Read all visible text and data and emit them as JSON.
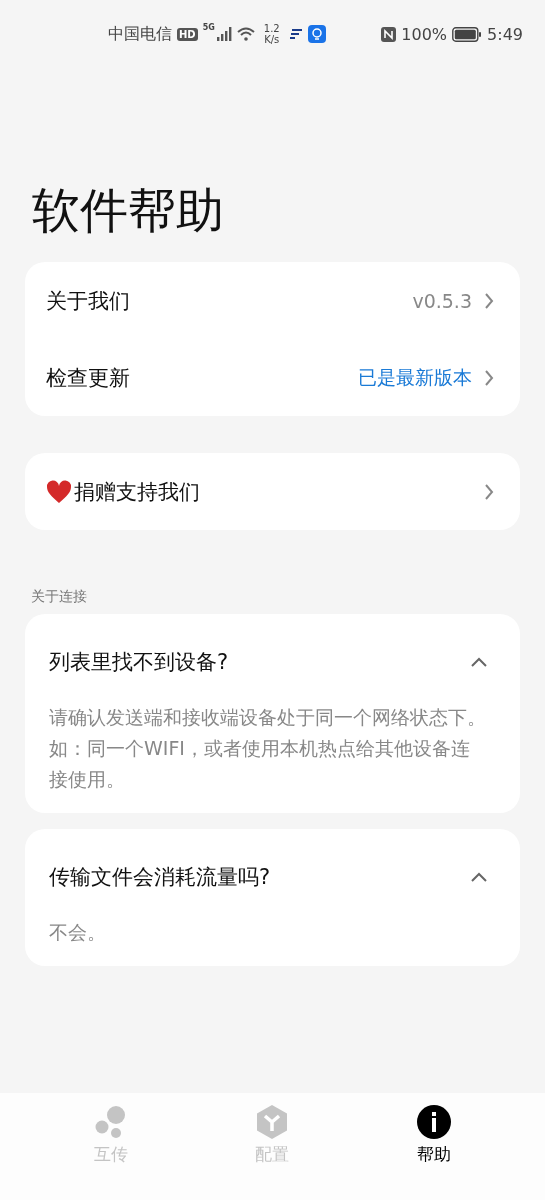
{
  "status_bar": {
    "carrier": "中国电信",
    "hd": "HD",
    "network": "5G",
    "speed_value": "1.2",
    "speed_unit": "K/s",
    "battery": "100%",
    "time": "5:49"
  },
  "title": "软件帮助",
  "info_card": [
    {
      "label": "关于我们",
      "value": "v0.5.3",
      "kind": "version"
    },
    {
      "label": "检查更新",
      "value": "已是最新版本",
      "kind": "status"
    }
  ],
  "donate": {
    "label": "捐赠支持我们"
  },
  "section_label": "关于连接",
  "faq": [
    {
      "question": "列表里找不到设备?",
      "expanded": true,
      "answer": "请确认发送端和接收端设备处于同一个网络状态下。如：同一个WIFI，或者使用本机热点给其他设备连接使用。"
    },
    {
      "question": "传输文件会消耗流量吗?",
      "expanded": true,
      "answer": "不会。"
    }
  ],
  "nav": [
    {
      "label": "互传",
      "selected": false,
      "kind": "share"
    },
    {
      "label": "配置",
      "selected": false,
      "kind": "config"
    },
    {
      "label": "帮助",
      "selected": true,
      "kind": "help"
    }
  ]
}
